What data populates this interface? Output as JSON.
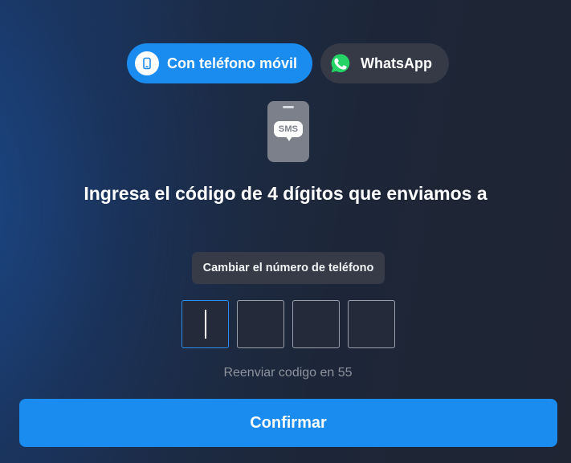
{
  "tabs": [
    {
      "label": "Con teléfono móvil",
      "icon": "phone-icon",
      "active": true
    },
    {
      "label": "WhatsApp",
      "icon": "whatsapp-icon",
      "active": false
    }
  ],
  "sms_badge": {
    "text": "SMS",
    "icon": "sms-phone-icon"
  },
  "heading": "Ingresa el código de 4 dígitos que enviamos a",
  "change_number_label": "Cambiar el número de teléfono",
  "code": {
    "digits": [
      "",
      "",
      "",
      ""
    ],
    "active_index": 0
  },
  "resend_text": "Reenviar codigo en 55",
  "confirm_label": "Confirmar",
  "colors": {
    "accent": "#1a8cf0",
    "whatsapp": "#25d366",
    "panel": "#373b48"
  }
}
